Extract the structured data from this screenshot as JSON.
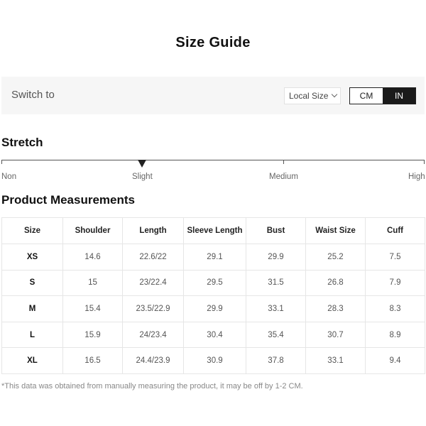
{
  "page_title": "Size Guide",
  "switch_bar": {
    "label": "Switch to",
    "local_size": "Local Size",
    "units": [
      "CM",
      "IN"
    ],
    "active_unit": "IN"
  },
  "stretch": {
    "title": "Stretch",
    "levels": [
      "Non",
      "Slight",
      "Medium",
      "High"
    ],
    "selected": "Slight"
  },
  "measurements": {
    "title": "Product Measurements",
    "columns": [
      "Size",
      "Shoulder",
      "Length",
      "Sleeve Length",
      "Bust",
      "Waist Size",
      "Cuff"
    ],
    "rows": [
      [
        "XS",
        "14.6",
        "22.6/22",
        "29.1",
        "29.9",
        "25.2",
        "7.5"
      ],
      [
        "S",
        "15",
        "23/22.4",
        "29.5",
        "31.5",
        "26.8",
        "7.9"
      ],
      [
        "M",
        "15.4",
        "23.5/22.9",
        "29.9",
        "33.1",
        "28.3",
        "8.3"
      ],
      [
        "L",
        "15.9",
        "24/23.4",
        "30.4",
        "35.4",
        "30.7",
        "8.9"
      ],
      [
        "XL",
        "16.5",
        "24.4/23.9",
        "30.9",
        "37.8",
        "33.1",
        "9.4"
      ]
    ]
  },
  "note": "*This data was obtained from manually measuring the product, it may be off by 1-2 CM."
}
